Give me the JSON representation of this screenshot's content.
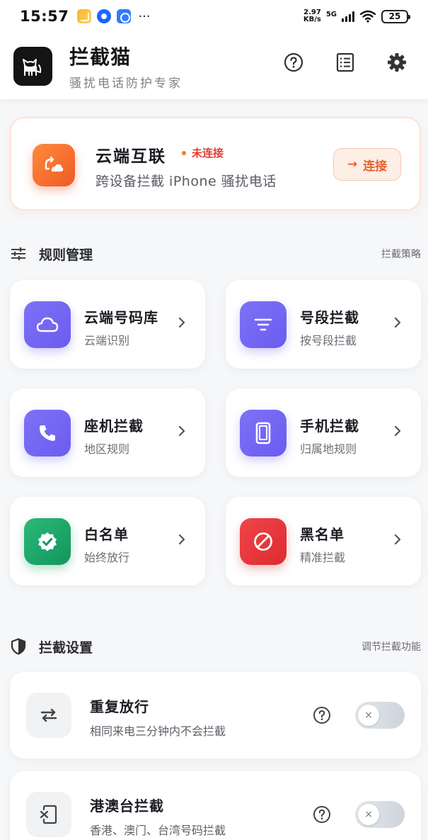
{
  "status_bar": {
    "time": "15:57",
    "more": "···",
    "speed_value": "2.97",
    "speed_unit": "KB/s",
    "network": "5G",
    "battery": "25"
  },
  "header": {
    "title": "拦截猫",
    "subtitle": "骚扰电话防护专家",
    "icons": [
      "help-icon",
      "log-list-icon",
      "gear-icon"
    ]
  },
  "cloud": {
    "title": "云端互联",
    "status": "未连接",
    "description": "跨设备拦截 iPhone 骚扰电话",
    "connect_arrow": "→",
    "connect_label": "连接",
    "accent": "#f05a24"
  },
  "rules_section": {
    "title": "规则管理",
    "right_label": "拦截策略",
    "items": [
      {
        "title": "云端号码库",
        "subtitle": "云端识别",
        "icon": "cloud-icon"
      },
      {
        "title": "号段拦截",
        "subtitle": "按号段拦截",
        "icon": "filter-icon"
      },
      {
        "title": "座机拦截",
        "subtitle": "地区规则",
        "icon": "phone-icon"
      },
      {
        "title": "手机拦截",
        "subtitle": "归属地规则",
        "icon": "mobile-icon"
      },
      {
        "title": "白名单",
        "subtitle": "始终放行",
        "icon": "verified-badge-icon"
      },
      {
        "title": "黑名单",
        "subtitle": "精准拦截",
        "icon": "block-icon"
      }
    ]
  },
  "settings_section": {
    "title": "拦截设置",
    "right_label": "调节拦截功能",
    "items": [
      {
        "title": "重复放行",
        "subtitle": "相同来电三分钟内不会拦截",
        "enabled": false,
        "toggle_glyph": "×"
      },
      {
        "title": "港澳台拦截",
        "subtitle": "香港、澳门、台湾号码拦截",
        "enabled": false,
        "toggle_glyph": "×"
      }
    ]
  },
  "colors": {
    "purple": "#6a5cf0",
    "green": "#12965c",
    "red": "#dc2b30",
    "status_red": "#e53a2f"
  }
}
